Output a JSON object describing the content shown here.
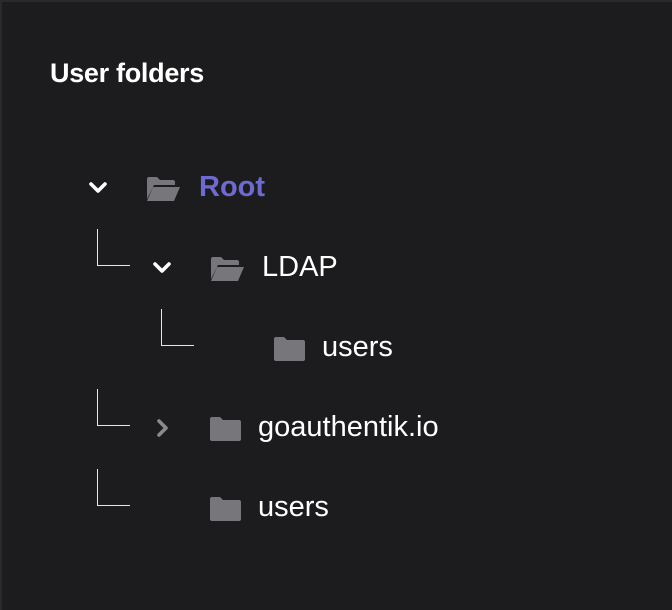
{
  "panel": {
    "title": "User folders"
  },
  "tree": {
    "root": {
      "label": "Root",
      "expanded": true,
      "selected": true,
      "icon": "folder-open-icon"
    },
    "ldap": {
      "label": "LDAP",
      "expanded": true,
      "icon": "folder-open-icon"
    },
    "ldap_users": {
      "label": "users",
      "icon": "folder-icon"
    },
    "goauthentik": {
      "label": "goauthentik.io",
      "expanded": false,
      "icon": "folder-icon"
    },
    "users": {
      "label": "users",
      "icon": "folder-icon"
    }
  },
  "colors": {
    "background": "#1c1c1e",
    "selected_text": "#6d6ad1",
    "folder_icon": "#77777b",
    "text": "#ffffff"
  }
}
